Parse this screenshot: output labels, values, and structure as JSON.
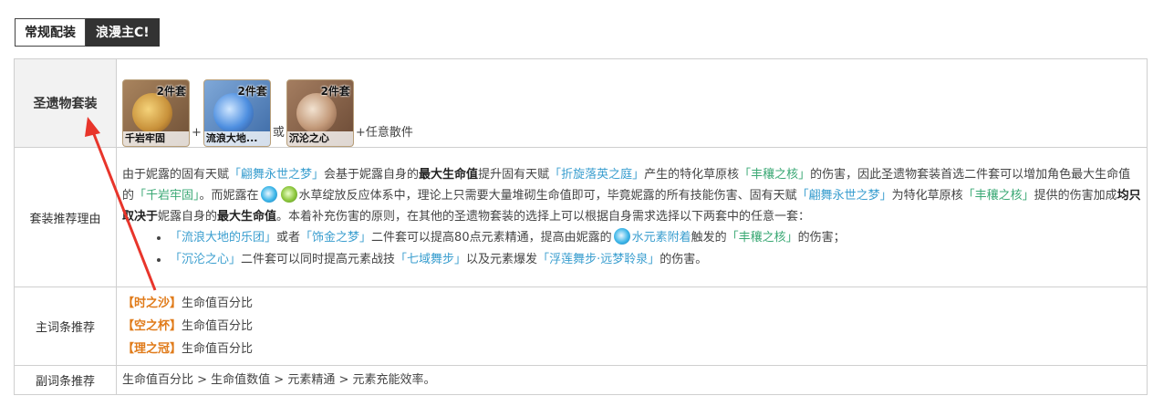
{
  "tabs": [
    {
      "label": "常规配装",
      "active": true
    },
    {
      "label": "浪漫主C!",
      "active": false
    }
  ],
  "rows": {
    "sets": {
      "label": "圣遗物套装",
      "cards": [
        {
          "badge": "2件套",
          "name": "千岩牢固"
        },
        {
          "badge": "2件套",
          "name": "流浪大地..."
        },
        {
          "badge": "2件套",
          "name": "沉沦之心"
        }
      ],
      "plus1": "+",
      "or": "或",
      "tail": "+任意散件"
    },
    "reason": {
      "label": "套装推荐理由",
      "p1": {
        "t1": "由于妮露的固有天赋",
        "l1": "「翩舞永世之梦」",
        "t2": "会基于妮露自身的",
        "b1": "最大生命值",
        "t3": "提升固有天赋",
        "l2": "「折旋落英之庭」",
        "t4": "产生的特化草原核",
        "l3": "「丰穰之核」",
        "t5": "的伤害，因此圣遗物套装首选二件套可以增加角色最大生命值的",
        "l4": "「千岩牢固」",
        "t6": "。而妮露在",
        "e1": "水草绽放",
        "t7": "反应体系中，理论上只需要大量堆砌生命值即可，毕竟妮露的所有技能伤害、固有天赋",
        "l5": "「翩舞永世之梦」",
        "t8": "为特化草原核",
        "l6": "「丰穰之核」",
        "t9": "提供的伤害加成",
        "b2": "均只取决于",
        "t10": "妮露自身的",
        "b3": "最大生命值",
        "t11": "。本着补充伤害的原则，在其他的圣遗物套装的选择上可以根据自身需求选择以下两套中的任意一套："
      },
      "opt1": {
        "l1": "「流浪大地的乐团」",
        "t1": "或者",
        "l2": "「饰金之梦」",
        "t2": "二件套可以提高80点元素精通，提高由妮露的",
        "l3": "水元素附着",
        "t3": "触发的",
        "l4": "「丰穰之核」",
        "t4": "的伤害；"
      },
      "opt2": {
        "l1": "「沉沦之心」",
        "t1": "二件套可以同时提高元素战技",
        "l2": "「七域舞步」",
        "t2": "以及元素爆发",
        "l3": "「浮莲舞步·远梦聆泉」",
        "t3": "的伤害。"
      }
    },
    "main": {
      "label": "主词条推荐",
      "items": [
        {
          "slot": "【时之沙】",
          "stat": "生命值百分比"
        },
        {
          "slot": "【空之杯】",
          "stat": "生命值百分比"
        },
        {
          "slot": "【理之冠】",
          "stat": "生命值百分比"
        }
      ]
    },
    "sub": {
      "label": "副词条推荐",
      "text": "生命值百分比 > 生命值数值 > 元素精通 > 元素充能效率。"
    }
  },
  "colors": {
    "link": "#3a9ecf",
    "green": "#3aa874",
    "slot": "#e07b1a",
    "annotation": "#e8352b"
  }
}
